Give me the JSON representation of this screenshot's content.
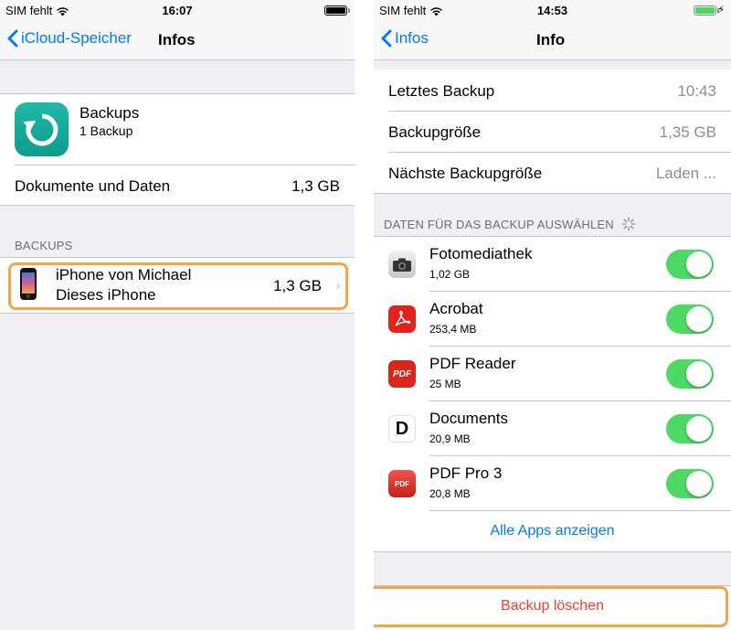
{
  "left": {
    "status": {
      "carrier": "SIM fehlt",
      "time": "16:07"
    },
    "nav": {
      "back_label": "iCloud-Speicher",
      "title": "Infos"
    },
    "backups_app": {
      "title": "Backups",
      "subtitle": "1 Backup"
    },
    "docs_row": {
      "label": "Dokumente und Daten",
      "value": "1,3 GB"
    },
    "section_header": "BACKUPS",
    "device_row": {
      "name": "iPhone von Michael",
      "subtitle": "Dieses iPhone",
      "size": "1,3 GB"
    }
  },
  "right": {
    "status": {
      "carrier": "SIM fehlt",
      "time": "14:53"
    },
    "nav": {
      "back_label": "Infos",
      "title": "Info"
    },
    "info_rows": [
      {
        "label": "Letztes Backup",
        "value": "10:43"
      },
      {
        "label": "Backupgröße",
        "value": "1,35 GB"
      },
      {
        "label": "Nächste Backupgröße",
        "value": "Laden ..."
      }
    ],
    "section_header": "DATEN FÜR DAS BACKUP AUSWÄHLEN",
    "apps": [
      {
        "name": "Fotomediathek",
        "size": "1,02 GB",
        "icon": "camera-icon",
        "enabled": true
      },
      {
        "name": "Acrobat",
        "size": "253,4 MB",
        "icon": "acrobat-icon",
        "enabled": true
      },
      {
        "name": "PDF Reader",
        "size": "25 MB",
        "icon": "pdf-reader-icon",
        "enabled": true
      },
      {
        "name": "Documents",
        "size": "20,9 MB",
        "icon": "documents-icon",
        "enabled": true
      },
      {
        "name": "PDF Pro 3",
        "size": "20,8 MB",
        "icon": "pdf-pro-icon",
        "enabled": true
      }
    ],
    "show_all": "Alle Apps anzeigen",
    "delete_backup": "Backup löschen"
  },
  "colors": {
    "accent": "#007aff",
    "toggle_on": "#4cd964",
    "destructive": "#ff3b30",
    "highlight": "#f7a34b",
    "backups_icon": "#1bafa0"
  }
}
